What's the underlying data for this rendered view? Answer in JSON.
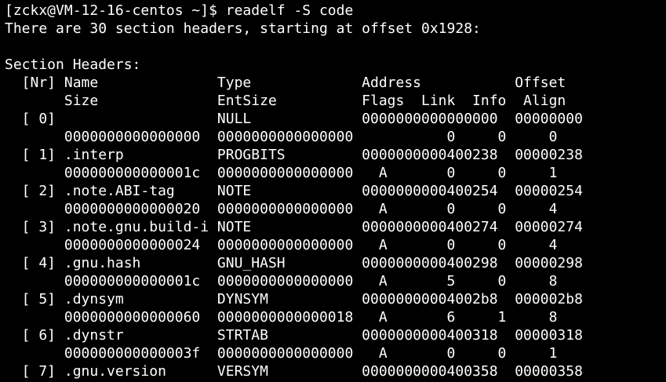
{
  "terminal": {
    "prompt_line": "[zckx@VM-12-16-centos ~]$ readelf -S code",
    "summary_line": "There are 30 section headers, starting at offset 0x1928:",
    "blank_line": "",
    "section_title": "Section Headers:",
    "header_line_1": "  [Nr] Name              Type             Address           Offset",
    "header_line_2": "       Size              EntSize          Flags  Link  Info  Align",
    "rows": [
      "  [ 0]                   NULL             0000000000000000  00000000",
      "       0000000000000000  0000000000000000           0     0     0",
      "  [ 1] .interp           PROGBITS         0000000000400238  00000238",
      "       000000000000001c  0000000000000000   A       0     0     1",
      "  [ 2] .note.ABI-tag     NOTE             0000000000400254  00000254",
      "       0000000000000020  0000000000000000   A       0     0     4",
      "  [ 3] .note.gnu.build-i NOTE             0000000000400274  00000274",
      "       0000000000000024  0000000000000000   A       0     0     4",
      "  [ 4] .gnu.hash         GNU_HASH         0000000000400298  00000298",
      "       000000000000001c  0000000000000000   A       5     0     8",
      "  [ 5] .dynsym           DYNSYM           00000000004002b8  000002b8",
      "       0000000000000060  0000000000000018   A       6     1     8",
      "  [ 6] .dynstr           STRTAB           0000000000400318  00000318",
      "       000000000000003f  0000000000000000   A       0     0     1",
      "  [ 7] .gnu.version      VERSYM           0000000000400358  00000358"
    ]
  },
  "colors": {
    "background": "#000000",
    "foreground": "#ffffff"
  }
}
